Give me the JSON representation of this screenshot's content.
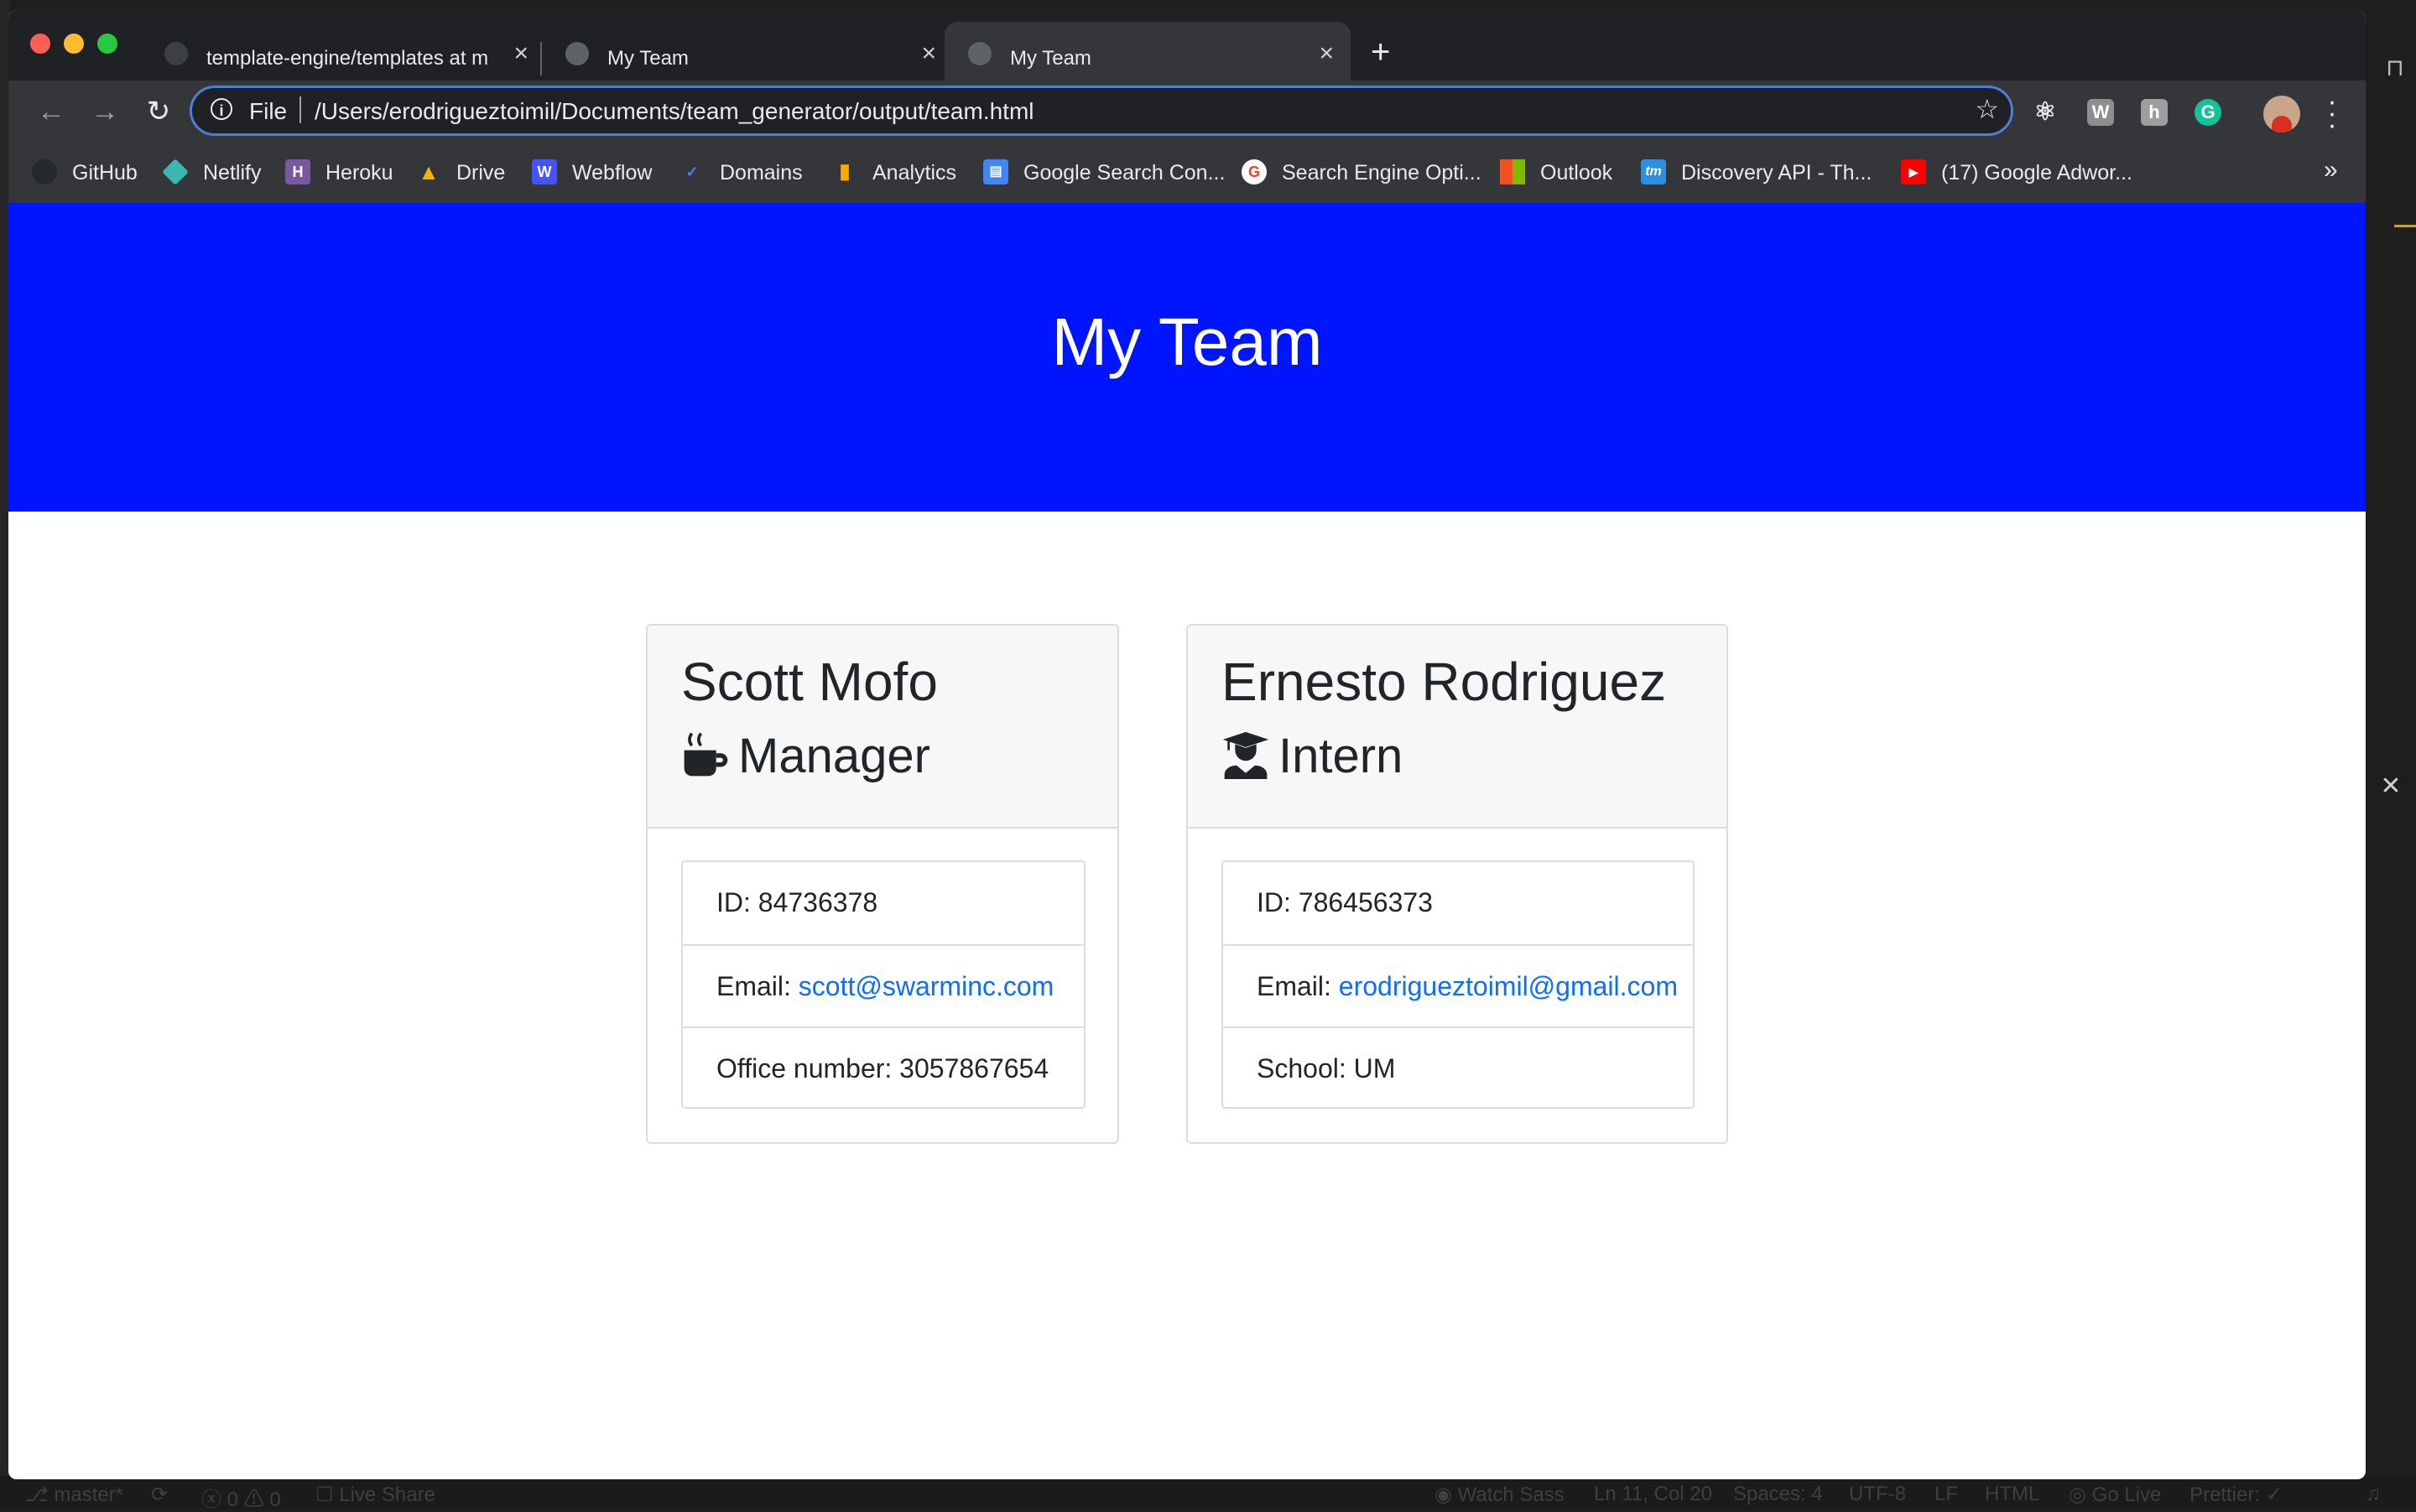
{
  "browser": {
    "tabs": [
      {
        "title": "template-engine/templates at m",
        "icon": "github-icon"
      },
      {
        "title": "My Team",
        "icon": "globe-icon"
      },
      {
        "title": "My Team",
        "icon": "globe-icon",
        "active": true
      }
    ],
    "address": {
      "scheme": "File",
      "url": "/Users/erodrigueztoimil/Documents/team_generator/output/team.html"
    },
    "bookmarks": [
      {
        "label": "GitHub",
        "color": "#24292e"
      },
      {
        "label": "Netlify",
        "color": "#3ab7b0"
      },
      {
        "label": "Heroku",
        "color": "#79589f"
      },
      {
        "label": "Drive",
        "color": "#1fa463"
      },
      {
        "label": "Webflow",
        "color": "#4353ff"
      },
      {
        "label": "Domains",
        "color": "#f4b400"
      },
      {
        "label": "Analytics",
        "color": "#f9ab00"
      },
      {
        "label": "Google Search Con...",
        "color": "#4285f4"
      },
      {
        "label": "Search Engine Opti...",
        "color": "#ffffff"
      },
      {
        "label": "Outlook",
        "color": "#f25022"
      },
      {
        "label": "Discovery API - Th...",
        "color": "#2d8fe0"
      },
      {
        "label": "(17) Google Adwor...",
        "color": "#ff0000"
      }
    ],
    "bookmarks_more": "»"
  },
  "page": {
    "header_title": "My Team",
    "cards": [
      {
        "name": "Scott Mofo",
        "role": "Manager",
        "role_icon": "coffee-mug-icon",
        "id_label": "ID: 84736378",
        "email_label": "Email: ",
        "email": "scott@swarminc.com",
        "extra_label": "Office number: 3057867654"
      },
      {
        "name": "Ernesto Rodriguez",
        "role": "Intern",
        "role_icon": "graduate-icon",
        "id_label": "ID: 786456373",
        "email_label": "Email: ",
        "email": "erodrigueztoimil@gmail.com",
        "extra_label": "School: UM"
      }
    ]
  },
  "vscode_status": {
    "branch": "master*",
    "problems": "0 ⚠ 0",
    "live_share": "Live Share",
    "watch_sass": "Watch Sass",
    "position": "Ln 11, Col 20",
    "spaces": "Spaces: 4",
    "encoding": "UTF-8",
    "eol": "LF",
    "language": "HTML",
    "go_live": "Go Live",
    "prettier": "Prettier: ✓"
  },
  "colors": {
    "header_bg": "#0015ff",
    "link": "#0d6efd",
    "omnibox_focus": "#4c7fd6"
  }
}
